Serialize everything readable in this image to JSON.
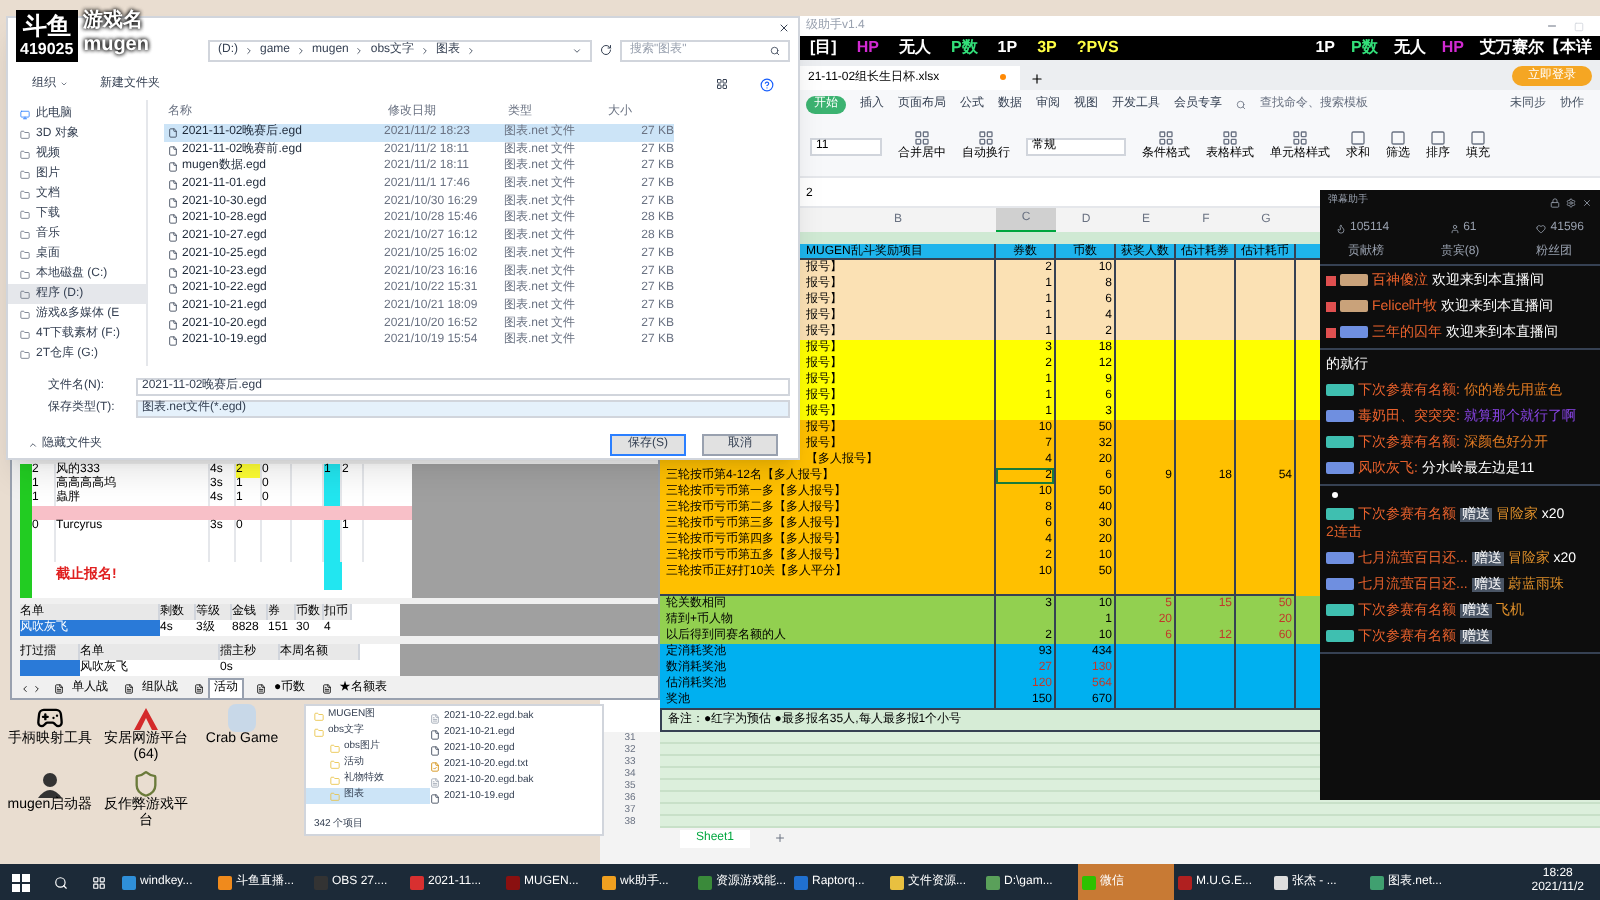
{
  "logo": {
    "brand": "斗鱼",
    "room": "419025",
    "game_label": "游戏名",
    "game": "mugen"
  },
  "save_dialog": {
    "path": [
      "(D:)",
      "game",
      "mugen",
      "obs文字",
      "图表"
    ],
    "search": {
      "placeholder": "搜索\"图表\""
    },
    "toolbar": [
      "组织",
      "新建文件夹"
    ],
    "nav": [
      {
        "label": "此电脑",
        "selected": false
      },
      {
        "label": "3D 对象",
        "selected": false
      },
      {
        "label": "视频",
        "selected": false
      },
      {
        "label": "图片",
        "selected": false
      },
      {
        "label": "文档",
        "selected": false
      },
      {
        "label": "下载",
        "selected": false
      },
      {
        "label": "音乐",
        "selected": false
      },
      {
        "label": "桌面",
        "selected": false
      },
      {
        "label": "本地磁盘 (C:)",
        "selected": false
      },
      {
        "label": "程序 (D:)",
        "selected": true
      },
      {
        "label": "游戏&多媒体 (E",
        "selected": false
      },
      {
        "label": "4T下载素材 (F:)",
        "selected": false
      },
      {
        "label": "2T仓库 (G:)",
        "selected": false
      }
    ],
    "columns": [
      "名称",
      "修改日期",
      "类型",
      "大小"
    ],
    "files": [
      {
        "name": "2021-11-02晚赛后.egd",
        "date": "2021/11/2 18:23",
        "type": "图表.net 文件",
        "size": "27 KB",
        "selected": true
      },
      {
        "name": "2021-11-02晚赛前.egd",
        "date": "2021/11/2 18:11",
        "type": "图表.net 文件",
        "size": "27 KB",
        "selected": false
      },
      {
        "name": "mugen数据.egd",
        "date": "2021/11/2 18:11",
        "type": "图表.net 文件",
        "size": "27 KB",
        "selected": false
      },
      {
        "name": "2021-11-01.egd",
        "date": "2021/11/1 17:46",
        "type": "图表.net 文件",
        "size": "27 KB",
        "selected": false
      },
      {
        "name": "2021-10-30.egd",
        "date": "2021/10/30 16:29",
        "type": "图表.net 文件",
        "size": "27 KB",
        "selected": false
      },
      {
        "name": "2021-10-28.egd",
        "date": "2021/10/28 15:46",
        "type": "图表.net 文件",
        "size": "28 KB",
        "selected": false
      },
      {
        "name": "2021-10-27.egd",
        "date": "2021/10/27 16:12",
        "type": "图表.net 文件",
        "size": "28 KB",
        "selected": false
      },
      {
        "name": "2021-10-25.egd",
        "date": "2021/10/25 16:02",
        "type": "图表.net 文件",
        "size": "27 KB",
        "selected": false
      },
      {
        "name": "2021-10-23.egd",
        "date": "2021/10/23 16:16",
        "type": "图表.net 文件",
        "size": "27 KB",
        "selected": false
      },
      {
        "name": "2021-10-22.egd",
        "date": "2021/10/22 15:31",
        "type": "图表.net 文件",
        "size": "27 KB",
        "selected": false
      },
      {
        "name": "2021-10-21.egd",
        "date": "2021/10/21 18:09",
        "type": "图表.net 文件",
        "size": "27 KB",
        "selected": false
      },
      {
        "name": "2021-10-20.egd",
        "date": "2021/10/20 16:52",
        "type": "图表.net 文件",
        "size": "27 KB",
        "selected": false
      },
      {
        "name": "2021-10-19.egd",
        "date": "2021/10/19 15:54",
        "type": "图表.net 文件",
        "size": "27 KB",
        "selected": false
      }
    ],
    "file_name_label": "文件名(N):",
    "file_name": "2021-11-02晚赛后.egd",
    "file_type_label": "保存类型(T):",
    "file_type": "图表.net文件(*.egd)",
    "hide_folders": "隐藏文件夹",
    "buttons": [
      "保存(S)",
      "取消"
    ]
  },
  "helper_window": {
    "title": "级助手v1.4"
  },
  "status_overlay": {
    "left": [
      {
        "text": "[目]",
        "kind": "plain"
      },
      {
        "text": "HP",
        "kind": "hp"
      },
      {
        "text": "无人",
        "kind": "plain"
      },
      {
        "text": "P数",
        "kind": "stat"
      },
      {
        "text": "1P",
        "kind": "plain"
      },
      {
        "text": "3P",
        "kind": "team"
      },
      {
        "text": "?PVS",
        "kind": "team"
      }
    ],
    "right": [
      {
        "text": "1P",
        "kind": "plain"
      },
      {
        "text": "P数",
        "kind": "stat"
      },
      {
        "text": "无人",
        "kind": "plain"
      },
      {
        "text": "HP",
        "kind": "hp"
      },
      {
        "text": "艾万赛尔【本详",
        "kind": "plain"
      }
    ]
  },
  "spreadsheet": {
    "doc_tab": "21-11-02组长生日杯.xlsx",
    "login": "立即登录",
    "ribbon_tabs": [
      {
        "label": "开始",
        "selected": true
      },
      {
        "label": "插入",
        "selected": false
      },
      {
        "label": "页面布局",
        "selected": false
      },
      {
        "label": "公式",
        "selected": false
      },
      {
        "label": "数据",
        "selected": false
      },
      {
        "label": "审阅",
        "selected": false
      },
      {
        "label": "视图",
        "selected": false
      },
      {
        "label": "开发工具",
        "selected": false
      },
      {
        "label": "会员专享",
        "selected": false
      }
    ],
    "search_placeholder": "查找命令、搜索模板",
    "sync": "未同步",
    "collab": "协作",
    "font_size": "11",
    "merge_tools": [
      "合并居中",
      "自动换行"
    ],
    "number_format": "常规",
    "style_tools": [
      "条件格式",
      "表格样式",
      "单元格样式"
    ],
    "edit_tools": [
      "求和",
      "筛选",
      "排序",
      "填充"
    ],
    "formula": "2",
    "columns": [
      {
        "label": "B",
        "selected": false
      },
      {
        "label": "C",
        "selected": true
      },
      {
        "label": "D",
        "selected": false
      },
      {
        "label": "E",
        "selected": false
      },
      {
        "label": "F",
        "selected": false
      },
      {
        "label": "G",
        "selected": false
      }
    ],
    "headers": [
      "MUGEN乱斗奖励项目",
      "券数",
      "币数",
      "获奖人数",
      "估计耗券",
      "估计耗币"
    ],
    "rows": [
      {
        "kind": "peach",
        "label_cut": true,
        "label": "报号】",
        "cells": [
          {
            "text": "2",
            "estimate": false,
            "selected": false
          },
          {
            "text": "10",
            "estimate": false,
            "selected": false
          },
          null,
          null,
          null
        ]
      },
      {
        "kind": "peach",
        "label_cut": true,
        "label": "报号】",
        "cells": [
          {
            "text": "1",
            "estimate": false,
            "selected": false
          },
          {
            "text": "8",
            "estimate": false,
            "selected": false
          },
          null,
          null,
          null
        ]
      },
      {
        "kind": "peach",
        "label_cut": true,
        "label": "报号】",
        "cells": [
          {
            "text": "1",
            "estimate": false,
            "selected": false
          },
          {
            "text": "6",
            "estimate": false,
            "selected": false
          },
          null,
          null,
          null
        ]
      },
      {
        "kind": "peach",
        "label_cut": true,
        "label": "报号】",
        "cells": [
          {
            "text": "1",
            "estimate": false,
            "selected": false
          },
          {
            "text": "4",
            "estimate": false,
            "selected": false
          },
          null,
          null,
          null
        ]
      },
      {
        "kind": "peach",
        "label_cut": true,
        "label": "报号】",
        "cells": [
          {
            "text": "1",
            "estimate": false,
            "selected": false
          },
          {
            "text": "2",
            "estimate": false,
            "selected": false
          },
          null,
          null,
          null
        ]
      },
      {
        "kind": "yellow",
        "label_cut": true,
        "label": "报号】",
        "cells": [
          {
            "text": "3",
            "estimate": false,
            "selected": false
          },
          {
            "text": "18",
            "estimate": false,
            "selected": false
          },
          null,
          null,
          null
        ]
      },
      {
        "kind": "yellow",
        "label_cut": true,
        "label": "报号】",
        "cells": [
          {
            "text": "2",
            "estimate": false,
            "selected": false
          },
          {
            "text": "12",
            "estimate": false,
            "selected": false
          },
          null,
          null,
          null
        ]
      },
      {
        "kind": "yellow",
        "label_cut": true,
        "label": "报号】",
        "cells": [
          {
            "text": "1",
            "estimate": false,
            "selected": false
          },
          {
            "text": "9",
            "estimate": false,
            "selected": false
          },
          null,
          null,
          null
        ]
      },
      {
        "kind": "yellow",
        "label_cut": true,
        "label": "报号】",
        "cells": [
          {
            "text": "1",
            "estimate": false,
            "selected": false
          },
          {
            "text": "6",
            "estimate": false,
            "selected": false
          },
          null,
          null,
          null
        ]
      },
      {
        "kind": "yellow",
        "label_cut": true,
        "label": "报号】",
        "cells": [
          {
            "text": "1",
            "estimate": false,
            "selected": false
          },
          {
            "text": "3",
            "estimate": false,
            "selected": false
          },
          null,
          null,
          null
        ]
      },
      {
        "kind": "orange",
        "label_cut": true,
        "label": "报号】",
        "cells": [
          {
            "text": "10",
            "estimate": false,
            "selected": false
          },
          {
            "text": "50",
            "estimate": false,
            "selected": false
          },
          null,
          null,
          null
        ]
      },
      {
        "kind": "orange",
        "label_cut": true,
        "label": "报号】",
        "cells": [
          {
            "text": "7",
            "estimate": false,
            "selected": false
          },
          {
            "text": "32",
            "estimate": false,
            "selected": false
          },
          null,
          null,
          null
        ]
      },
      {
        "kind": "orange",
        "label_cut": true,
        "label": "【多人报号】",
        "cells": [
          {
            "text": "4",
            "estimate": false,
            "selected": false
          },
          {
            "text": "20",
            "estimate": false,
            "selected": false
          },
          null,
          null,
          null
        ]
      },
      {
        "kind": "orange",
        "label_cut": false,
        "label": "三轮按币第4-12名【多人报号】",
        "cells": [
          {
            "text": "2",
            "estimate": false,
            "selected": true
          },
          {
            "text": "6",
            "estimate": false,
            "selected": false
          },
          {
            "text": "9",
            "estimate": false,
            "selected": false
          },
          {
            "text": "18",
            "estimate": false,
            "selected": false
          },
          {
            "text": "54",
            "estimate": false,
            "selected": false
          }
        ]
      },
      {
        "kind": "orange",
        "label_cut": false,
        "label": "三轮按币亏币第一多【多人报号】",
        "cells": [
          {
            "text": "10",
            "estimate": false,
            "selected": false
          },
          {
            "text": "50",
            "estimate": false,
            "selected": false
          },
          null,
          null,
          null
        ]
      },
      {
        "kind": "orange",
        "label_cut": false,
        "label": "三轮按币亏币第二多【多人报号】",
        "cells": [
          {
            "text": "8",
            "estimate": false,
            "selected": false
          },
          {
            "text": "40",
            "estimate": false,
            "selected": false
          },
          null,
          null,
          null
        ]
      },
      {
        "kind": "orange",
        "label_cut": false,
        "label": "三轮按币亏币第三多【多人报号】",
        "cells": [
          {
            "text": "6",
            "estimate": false,
            "selected": false
          },
          {
            "text": "30",
            "estimate": false,
            "selected": false
          },
          null,
          null,
          null
        ]
      },
      {
        "kind": "orange",
        "label_cut": false,
        "label": "三轮按币亏币第四多【多人报号】",
        "cells": [
          {
            "text": "4",
            "estimate": false,
            "selected": false
          },
          {
            "text": "20",
            "estimate": false,
            "selected": false
          },
          null,
          null,
          null
        ]
      },
      {
        "kind": "orange",
        "label_cut": false,
        "label": "三轮按币亏币第五多【多人报号】",
        "cells": [
          {
            "text": "2",
            "estimate": false,
            "selected": false
          },
          {
            "text": "10",
            "estimate": false,
            "selected": false
          },
          null,
          null,
          null
        ]
      },
      {
        "kind": "orange",
        "label_cut": false,
        "label": "三轮按币正好打10关【多人平分】",
        "cells": [
          {
            "text": "10",
            "estimate": false,
            "selected": false
          },
          {
            "text": "50",
            "estimate": false,
            "selected": false
          },
          null,
          null,
          null
        ]
      },
      {
        "kind": "orange",
        "cells": [
          null,
          null,
          null,
          null,
          null
        ]
      },
      {
        "kind": "green",
        "label_cut": false,
        "label": "轮关数相同",
        "cells": [
          {
            "text": "3",
            "estimate": false,
            "selected": false
          },
          {
            "text": "10",
            "estimate": false,
            "selected": false
          },
          {
            "text": "5",
            "estimate": true,
            "selected": false
          },
          {
            "text": "15",
            "estimate": true,
            "selected": false
          },
          {
            "text": "50",
            "estimate": true,
            "selected": false
          }
        ]
      },
      {
        "kind": "green",
        "label_cut": false,
        "label": "猜到+币人物",
        "cells": [
          null,
          {
            "text": "1",
            "estimate": false,
            "selected": false
          },
          {
            "text": "20",
            "estimate": true,
            "selected": false
          },
          null,
          {
            "text": "20",
            "estimate": true,
            "selected": false
          }
        ]
      },
      {
        "kind": "green",
        "label_cut": false,
        "label": "以后得到同赛名额的人",
        "cells": [
          {
            "text": "2",
            "estimate": false,
            "selected": false
          },
          {
            "text": "10",
            "estimate": false,
            "selected": false
          },
          {
            "text": "6",
            "estimate": true,
            "selected": false
          },
          {
            "text": "12",
            "estimate": true,
            "selected": false
          },
          {
            "text": "60",
            "estimate": true,
            "selected": false
          }
        ]
      },
      {
        "kind": "blue",
        "label_cut": false,
        "label": "定消耗奖池",
        "cells": [
          {
            "text": "93",
            "estimate": false,
            "selected": false
          },
          {
            "text": "434",
            "estimate": false,
            "selected": false
          },
          null,
          null,
          null
        ]
      },
      {
        "kind": "blue",
        "label_cut": false,
        "label": "数消耗奖池",
        "cells": [
          {
            "text": "27",
            "estimate": true,
            "selected": false
          },
          {
            "text": "130",
            "estimate": true,
            "selected": false
          },
          null,
          null,
          null
        ]
      },
      {
        "kind": "blue",
        "label_cut": false,
        "label": "估消耗奖池",
        "cells": [
          {
            "text": "120",
            "estimate": true,
            "selected": false
          },
          {
            "text": "564",
            "estimate": true,
            "selected": false
          },
          null,
          null,
          null
        ]
      },
      {
        "kind": "blue",
        "label_cut": false,
        "label": "奖池",
        "cells": [
          {
            "text": "150",
            "estimate": false,
            "selected": false
          },
          {
            "text": "670",
            "estimate": false,
            "selected": false
          },
          null,
          null,
          null
        ]
      }
    ],
    "note": "备注：●红字为预估 ●最多报名35人,每人最多报1个小号",
    "empty_rows": [
      "31",
      "32",
      "33",
      "34",
      "35",
      "36",
      "37",
      "38"
    ],
    "sheets": [
      {
        "label": "Sheet1",
        "selected": true
      }
    ]
  },
  "chat": {
    "title": "弹幕助手",
    "stats": [
      "105114",
      "61",
      "41596"
    ],
    "tabs": [
      {
        "label": "贡献榜",
        "selected": false
      },
      {
        "label": "贵宾(8)",
        "selected": false
      },
      {
        "label": "粉丝团",
        "selected": false
      }
    ],
    "sections": [
      [
        {
          "kind": "enter",
          "color": "#c9a27a",
          "name": "百神傻泣",
          "text": "欢迎来到本直播间"
        },
        {
          "kind": "enter",
          "color": "#c9a27a",
          "name": "Felice叶牧",
          "text": "欢迎来到本直播间"
        },
        {
          "kind": "enter",
          "color": "#6f8fe0",
          "name": "三年的囚年",
          "text": "欢迎来到本直播间"
        }
      ],
      [
        {
          "kind": "line",
          "text": "的就行"
        },
        {
          "kind": "chat",
          "color": "#3fbfb0",
          "name": "下次参赛有名额:",
          "text": "你的卷先用蓝色"
        },
        {
          "kind": "reply",
          "color": "#6f8fe0",
          "name": "毒奶田、突突突:",
          "text": "就算那个就行了啊"
        },
        {
          "kind": "chat",
          "color": "#3fbfb0",
          "name": "下次参赛有名额:",
          "text": "深颜色好分开"
        },
        {
          "kind": "plain",
          "color": "#6f8fe0",
          "name": "风吹灰飞:",
          "text": "分水岭最左边是11"
        }
      ],
      [
        {
          "kind": "gift",
          "color": "#3fbfb0",
          "name": "下次参赛有名额",
          "action": "赠送",
          "gift": "冒险家",
          "count": "x20",
          "combo": "2连击"
        },
        {
          "kind": "gift",
          "color": "#6f8fe0",
          "name": "七月流萤百日还...",
          "action": "赠送",
          "gift": "冒险家",
          "count": "x20"
        },
        {
          "kind": "gift",
          "color": "#6f8fe0",
          "name": "七月流萤百日还...",
          "action": "赠送",
          "gift": "蔚蓝雨珠"
        },
        {
          "kind": "gift",
          "color": "#3fbfb0",
          "name": "下次参赛有名额",
          "action": "赠送",
          "gift": "飞机"
        },
        {
          "kind": "gift",
          "color": "#3fbfb0",
          "name": "下次参赛有名额",
          "action": "赠送"
        }
      ]
    ]
  },
  "roster": {
    "rows": [
      {
        "kind": "player",
        "marked": true,
        "cells": [
          "2",
          "风的333",
          "4s",
          "2",
          "0",
          null,
          "1",
          "2"
        ]
      },
      {
        "kind": "player",
        "marked": false,
        "cells": [
          "1",
          "高高高高坞",
          "3s",
          "1",
          "0",
          null,
          null,
          null
        ]
      },
      {
        "kind": "player",
        "marked": false,
        "cells": [
          "1",
          "蟲胖",
          "4s",
          "1",
          "0",
          null,
          null,
          null
        ]
      },
      {
        "kind": "gap"
      },
      {
        "kind": "player",
        "marked": false,
        "cells": [
          "0",
          "Turcyrus",
          "3s",
          "0",
          null,
          null,
          null,
          "1"
        ]
      },
      {
        "kind": "blank"
      },
      {
        "kind": "blank"
      },
      {
        "kind": "notice",
        "text": "截止报名!"
      }
    ],
    "detail_headers": [
      "名单",
      "剩数",
      "等级",
      "金钱",
      "券",
      "币数",
      "扣币"
    ],
    "detail_row": [
      "风吹灰飞",
      "4s",
      "3级",
      "8828",
      "151",
      "30",
      "4"
    ],
    "ring_headers": [
      "打过擂",
      "名单",
      "擂主秒",
      "本周名额"
    ],
    "ring_row": {
      "name": "风吹灰飞",
      "seconds": "0s"
    },
    "tabs": [
      {
        "label": "单人战",
        "selected": false
      },
      {
        "label": "组队战",
        "selected": false
      },
      {
        "label": "活动",
        "selected": true
      },
      {
        "label": "●币数",
        "selected": false
      },
      {
        "label": "★名额表",
        "selected": false
      }
    ]
  },
  "desktop_icons": [
    {
      "kind": "gamepad",
      "label": "手柄映射工具"
    },
    {
      "kind": "peak",
      "label": "安居网游平台(64)"
    },
    {
      "kind": "crab",
      "label": "Crab Game"
    },
    {
      "kind": "avatar",
      "label": "mugen启动器"
    },
    {
      "kind": "shield",
      "label": "反作弊游戏平台"
    }
  ],
  "explorer": {
    "tree": [
      {
        "label": "MUGEN图",
        "selected": false
      },
      {
        "label": "obs文字",
        "selected": false,
        "children": [
          {
            "label": "obs图片",
            "selected": false
          },
          {
            "label": "活动",
            "selected": false
          },
          {
            "label": "礼物特效",
            "selected": false
          },
          {
            "label": "图表",
            "selected": true
          }
        ]
      }
    ],
    "files": [
      {
        "name": "2021-10-22.egd.bak",
        "kind": "bak"
      },
      {
        "name": "2021-10-21.egd",
        "kind": "egd"
      },
      {
        "name": "2021-10-20.egd",
        "kind": "egd"
      },
      {
        "name": "2021-10-20.egd.txt",
        "kind": "txt"
      },
      {
        "name": "2021-10-20.egd.bak",
        "kind": "bak"
      },
      {
        "name": "2021-10-19.egd",
        "kind": "egd"
      }
    ],
    "status": "342 个项目"
  },
  "taskbar": {
    "items": [
      {
        "label": "windkey...",
        "color": "#2f8fd8",
        "selected": false
      },
      {
        "label": "斗鱼直播...",
        "color": "#f08a1c",
        "selected": false
      },
      {
        "label": "OBS 27....",
        "color": "#333333",
        "selected": false
      },
      {
        "label": "2021-11...",
        "color": "#d83030",
        "selected": false
      },
      {
        "label": "MUGEN...",
        "color": "#8a1010",
        "selected": false
      },
      {
        "label": "wk助手...",
        "color": "#f0a020",
        "selected": false
      },
      {
        "label": "资源游戏能...",
        "color": "#3a8a3a",
        "selected": false
      },
      {
        "label": "Raptorq...",
        "color": "#2070d0",
        "selected": false
      },
      {
        "label": "文件资源...",
        "color": "#e8c040",
        "selected": false
      },
      {
        "label": "D:\\gam...",
        "color": "#5aa05a",
        "selected": false
      },
      {
        "label": "微信",
        "color": "#2dc100",
        "selected": true
      },
      {
        "label": "M.U.G.E...",
        "color": "#b02020",
        "selected": false
      },
      {
        "label": "张杰 - ...",
        "color": "#dddddd",
        "selected": false
      },
      {
        "label": "图表.net...",
        "color": "#40a070",
        "selected": false
      }
    ],
    "time": "18:28",
    "date": "2021/11/2"
  }
}
